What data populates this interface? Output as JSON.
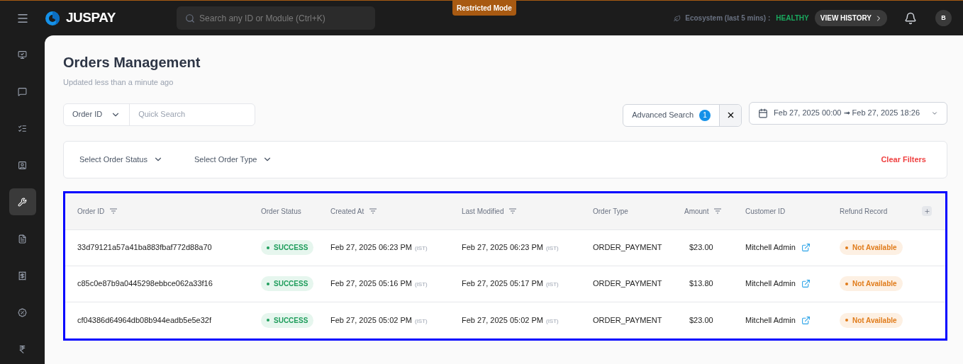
{
  "topbar": {
    "brand": "JUSPAY",
    "search": {
      "placeholder": "Search any ID or Module (Ctrl+K)"
    },
    "mode_badge": "Restricted Mode",
    "ecosystem_label": "Ecosystem (last 5 mins) :",
    "ecosystem_status": "HEALTHY",
    "history_button": "VIEW HISTORY",
    "avatar": "B"
  },
  "sidebar": {
    "items": [
      {
        "selected": false
      },
      {
        "selected": false
      },
      {
        "selected": false
      },
      {
        "selected": false
      },
      {
        "selected": true
      },
      {
        "selected": false
      },
      {
        "selected": false
      },
      {
        "selected": false
      },
      {
        "selected": false
      }
    ]
  },
  "page": {
    "title": "Orders Management",
    "subtitle": "Updated less than a minute ago"
  },
  "search": {
    "field_select": "Order ID",
    "placeholder": "Quick Search"
  },
  "advanced_search": {
    "label": "Advanced Search",
    "count": "1"
  },
  "date_range": "Feb 27, 2025 00:00 ➟ Feb 27, 2025 18:26",
  "filters": {
    "items": [
      "Select Order Status",
      "Select Order Type"
    ],
    "clear": "Clear Filters"
  },
  "table": {
    "columns": [
      {
        "label": "Order ID",
        "filter": true
      },
      {
        "label": "Order Status",
        "filter": false
      },
      {
        "label": "Created At",
        "filter": true
      },
      {
        "label": "Last Modified",
        "filter": true
      },
      {
        "label": "Order Type",
        "filter": false
      },
      {
        "label": "Amount",
        "filter": true
      },
      {
        "label": "Customer ID",
        "filter": false
      },
      {
        "label": "Refund Record",
        "filter": false
      }
    ],
    "rows": [
      {
        "order_id": "33d79121a57a41ba883fbaf772d88a70",
        "status": {
          "kind": "success",
          "label": "SUCCESS"
        },
        "created": "Feb 27, 2025 06:23 PM",
        "created_tz": "(IST)",
        "modified": "Feb 27, 2025 06:23 PM",
        "modified_tz": "(IST)",
        "type": "ORDER_PAYMENT",
        "amount": "$23.00",
        "customer": "Mitchell Admin",
        "refund": {
          "kind": "unavailable",
          "label": "Not Available"
        }
      },
      {
        "order_id": "c85c0e87b9a0445298ebbce062a33f16",
        "status": {
          "kind": "success",
          "label": "SUCCESS"
        },
        "created": "Feb 27, 2025 05:16 PM",
        "created_tz": "(IST)",
        "modified": "Feb 27, 2025 05:17 PM",
        "modified_tz": "(IST)",
        "type": "ORDER_PAYMENT",
        "amount": "$13.80",
        "customer": "Mitchell Admin",
        "refund": {
          "kind": "unavailable",
          "label": "Not Available"
        }
      },
      {
        "order_id": "cf04386d64964db08b944eadb5e5e32f",
        "status": {
          "kind": "success",
          "label": "SUCCESS"
        },
        "created": "Feb 27, 2025 05:02 PM",
        "created_tz": "(IST)",
        "modified": "Feb 27, 2025 05:02 PM",
        "modified_tz": "(IST)",
        "type": "ORDER_PAYMENT",
        "amount": "$23.00",
        "customer": "Mitchell Admin",
        "refund": {
          "kind": "unavailable",
          "label": "Not Available"
        }
      }
    ]
  }
}
